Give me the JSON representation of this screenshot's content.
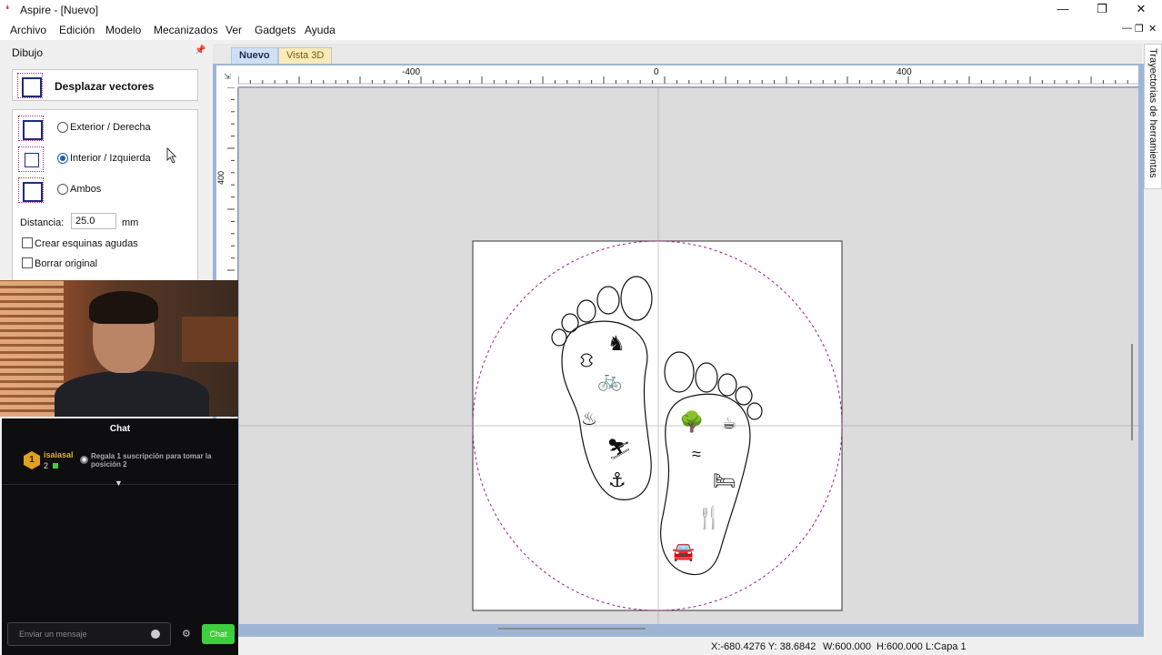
{
  "window": {
    "title": "Aspire - [Nuevo]"
  },
  "menu": [
    "Archivo",
    "Edición",
    "Modelo",
    "Mecanizados",
    "Ver",
    "Gadgets",
    "Ayuda"
  ],
  "panel": {
    "title": "Dibujo",
    "tool_label": "Desplazar vectores",
    "options": [
      "Exterior / Derecha",
      "Interior / Izquierda",
      "Ambos"
    ],
    "selected_option": "Interior / Izquierda",
    "distance_label": "Distancia:",
    "distance_value": "25.0",
    "distance_unit": "mm",
    "sharp_corners_label": "Crear esquinas agudas",
    "delete_original_label": "Borrar original"
  },
  "tabs": [
    "Nuevo",
    "Vista 3D"
  ],
  "ruler": {
    "top_ticks": [
      "-400",
      "0",
      "400"
    ],
    "left_tick": "400"
  },
  "sidebar_tab": "Trayectorias de herramientas",
  "status": {
    "coords": "X:-680.4276 Y: 38.6842",
    "width": "W:600.000",
    "height": "H:600.000",
    "layer": "L:Capa 1"
  },
  "chat": {
    "header": "Chat",
    "rank": "1",
    "user": "isaiasal",
    "count": "2",
    "gift_message": "Regala 1 suscripción para tomar la posición 2",
    "input_placeholder": "Enviar un mensaje",
    "send_label": "Chat"
  },
  "colors": {
    "accent": "#1e5fb0",
    "offset_circle": "#a0208a",
    "chat_send": "#3ecf3e"
  }
}
